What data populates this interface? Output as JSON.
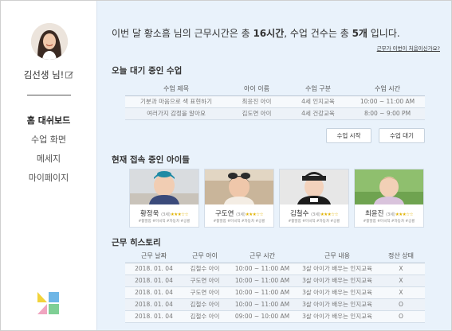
{
  "sidebar": {
    "teacher_name": "김선생 님!",
    "nav": [
      {
        "label": "홈 대쉬보드",
        "active": true
      },
      {
        "label": "수업 화면",
        "active": false
      },
      {
        "label": "메세지",
        "active": false
      },
      {
        "label": "마이페이지",
        "active": false
      }
    ]
  },
  "header": {
    "pre": "이번 달 황소흠 님의 근무시간은 총 ",
    "hours": "16시간",
    "mid": ", 수업 건수는 총 ",
    "count": "5개",
    "post": " 입니다.",
    "first_time_link": "근무가 이번이 처음이신가요?"
  },
  "waiting_classes": {
    "title": "오늘 대기 중인 수업",
    "columns": [
      "수업 제목",
      "아이 이름",
      "수업 구분",
      "수업 시간"
    ],
    "rows": [
      [
        "기분과 마음으로 색 표현하기",
        "최윤진 아이",
        "4세 인지교육",
        "10:00 ~ 11:00 AM"
      ],
      [
        "여러가지 감정을 알아요",
        "김도연 아이",
        "4세 건강교육",
        "8:00 ~ 9:00 PM"
      ]
    ],
    "start_button": "수업 시작",
    "wait_button": "수업 대기"
  },
  "connected_kids": {
    "title": "현재 접속 중인 아이들",
    "kids": [
      {
        "name": "황정욱",
        "age": "(3세)",
        "stars": "★★★☆☆",
        "tags": "#활발함 #미국적 #자동차 #공룡"
      },
      {
        "name": "구도연",
        "age": "(3세)",
        "stars": "★★★☆☆",
        "tags": "#활발함 #미국적 #자동차 #공룡"
      },
      {
        "name": "김철수",
        "age": "(3세)",
        "stars": "★★★☆☆",
        "tags": "#활발함 #미국적 #자동차 #공룡"
      },
      {
        "name": "최윤진",
        "age": "(3세)",
        "stars": "★★★☆☆",
        "tags": "#활발함 #미국적 #자동차 #공룡"
      }
    ]
  },
  "history": {
    "title": "근무 히스토리",
    "columns": [
      "근무 날짜",
      "근무 아이",
      "근무 시간",
      "근무 내용",
      "정산 상태"
    ],
    "rows": [
      [
        "2018. 01. 04",
        "김철수 아이",
        "10:00 ~ 11:00 AM",
        "3살 아이가 배우는 인지교육",
        "X"
      ],
      [
        "2018. 01. 04",
        "구도연 아이",
        "10:00 ~ 11:00 AM",
        "3살 아이가 배우는 인지교육",
        "X"
      ],
      [
        "2018. 01. 04",
        "구도연 아이",
        "10:00 ~ 11:00 AM",
        "3살 아이가 배우는 인지교육",
        "X"
      ],
      [
        "2018. 01. 04",
        "김철수 아이",
        "10:00 ~ 11:00 AM",
        "3살 아이가 배우는 인지교육",
        "O"
      ],
      [
        "2018. 01. 04",
        "김철수 아이",
        "09:00 ~ 10:00 AM",
        "3살 아이가 배우는 인지교육",
        "O"
      ]
    ]
  },
  "colors": {
    "main_bg": "#e9f2fb",
    "logo_yellow": "#f2d33a",
    "logo_blue": "#6eb6e6",
    "logo_pink": "#f0a5c0",
    "logo_green": "#7fcf95"
  }
}
